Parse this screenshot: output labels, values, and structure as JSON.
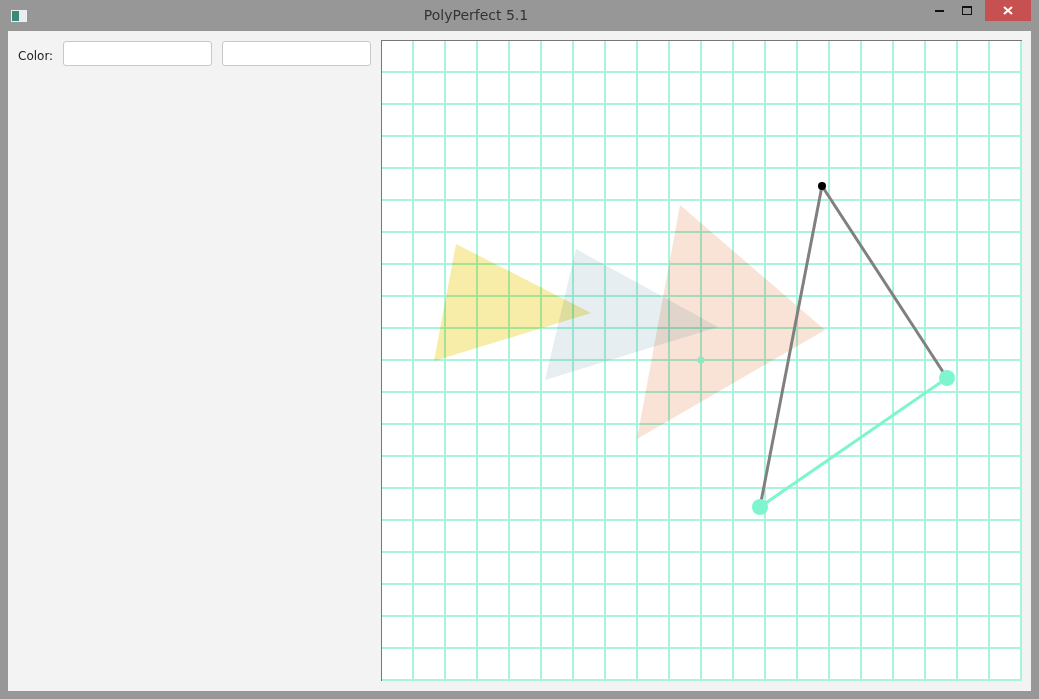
{
  "window": {
    "title": "PolyPerfect 5.1"
  },
  "sidebar": {
    "label": "Color:"
  },
  "canvas": {
    "shapes": [
      {
        "color": "#f7eda8"
      },
      {
        "color": "#e6eef1"
      },
      {
        "color": "#f9e3d7"
      }
    ]
  }
}
